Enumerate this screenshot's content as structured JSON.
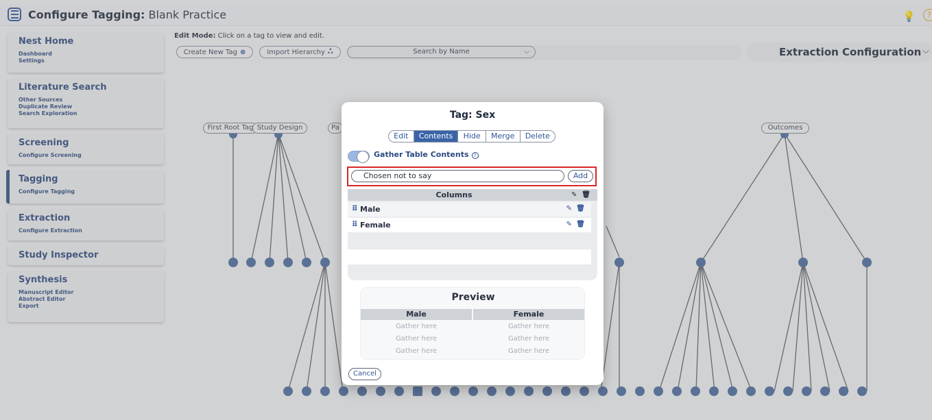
{
  "header": {
    "title_bold": "Configure Tagging:",
    "title_rest": " Blank Practice",
    "menu_icon": "hamburger-icon",
    "tip_icon": "lightbulb-icon",
    "help_glyph": "?"
  },
  "sidebar": {
    "sections": [
      {
        "title": "Nest Home",
        "items": [
          "Dashboard",
          "Settings"
        ]
      },
      {
        "title": "Literature Search",
        "items": [
          "Other Sources",
          "Duplicate Review",
          "Search Exploration"
        ]
      },
      {
        "title": "Screening",
        "items": [
          "Configure Screening"
        ]
      },
      {
        "title": "Tagging",
        "items": [
          "Configure Tagging"
        ],
        "active": true
      },
      {
        "title": "Extraction",
        "items": [
          "Configure Extraction"
        ]
      },
      {
        "title": "Study Inspector",
        "items": []
      },
      {
        "title": "Synthesis",
        "items": [
          "Manuscript Editor",
          "Abstract Editor",
          "Export"
        ]
      }
    ]
  },
  "toolbar": {
    "edit_mode_bold": "Edit Mode:",
    "edit_mode_text": " Click on a tag to view and edit.",
    "create_new_tag": "Create New Tag",
    "create_icon": "⊕",
    "import_hierarchy": "Import Hierarchy",
    "import_icon": "ஃ",
    "search_placeholder": "Search by Name",
    "chevron": "⌵",
    "extraction_configuration": "Extraction Configuration"
  },
  "tree": {
    "labels": [
      "First Root Tag",
      "Study Design",
      "Pa",
      "Outcomes"
    ],
    "node_color": "#4a6aa0",
    "line_color": "#5a5f68"
  },
  "modal": {
    "title": "Tag: Sex",
    "tabs": [
      "Edit",
      "Contents",
      "Hide",
      "Merge",
      "Delete"
    ],
    "active_tab": "Contents",
    "gather_label": "Gather Table Contents",
    "gather_enabled": true,
    "help_glyph": "?",
    "input_value": "Chosen not to say",
    "add_label": "Add",
    "columns_header": "Columns",
    "edit_glyph": "✎",
    "delete_glyph": "🗑",
    "grip_glyph": "⠿",
    "columns": [
      "Male",
      "Female"
    ],
    "preview": {
      "title": "Preview",
      "headers": [
        "Male",
        "Female"
      ],
      "placeholder": "Gather here",
      "rows": 3
    },
    "cancel_label": "Cancel"
  }
}
